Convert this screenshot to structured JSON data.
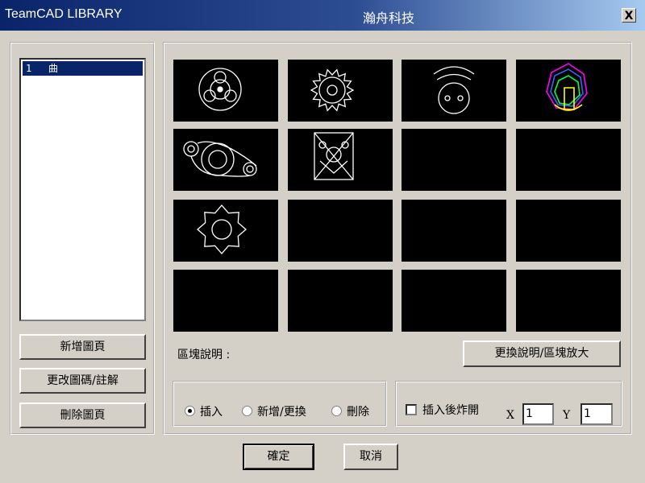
{
  "window": {
    "title": "TeamCAD LIBRARY",
    "subtitle": "瀚舟科技",
    "close_label": "X"
  },
  "pages_list": {
    "items": [
      {
        "number": "1",
        "name": "曲"
      }
    ]
  },
  "left_buttons": {
    "add_page": "新增圖頁",
    "rename_page": "更改圖碼/註解",
    "delete_page": "刪除圖頁"
  },
  "blocks": [
    {
      "icon": "gear-wheel-icon"
    },
    {
      "icon": "saw-blade-icon"
    },
    {
      "icon": "pig-nose-icon"
    },
    {
      "icon": "polygon-colored-icon"
    },
    {
      "icon": "cam-link-icon"
    },
    {
      "icon": "frame-face-icon"
    },
    {
      "icon": ""
    },
    {
      "icon": ""
    },
    {
      "icon": "small-gear-icon"
    },
    {
      "icon": ""
    },
    {
      "icon": ""
    },
    {
      "icon": ""
    },
    {
      "icon": ""
    },
    {
      "icon": ""
    },
    {
      "icon": ""
    },
    {
      "icon": ""
    }
  ],
  "block_description": {
    "label": "區塊說明 :",
    "value": ""
  },
  "change_desc_button": "更換說明/區塊放大",
  "mode": {
    "options": [
      "插入",
      "新增/更換",
      "刪除"
    ],
    "selected": "插入"
  },
  "explode": {
    "label": "插入後炸開",
    "checked": false
  },
  "scale": {
    "x_label": "X",
    "x_value": "1",
    "y_label": "Y",
    "y_value": "1"
  },
  "footer": {
    "ok": "確定",
    "cancel": "取消"
  },
  "colors": {
    "title_start": "#0a246a",
    "title_end": "#a6caf0",
    "face": "#d4d0c8",
    "selection": "#0a246a"
  }
}
